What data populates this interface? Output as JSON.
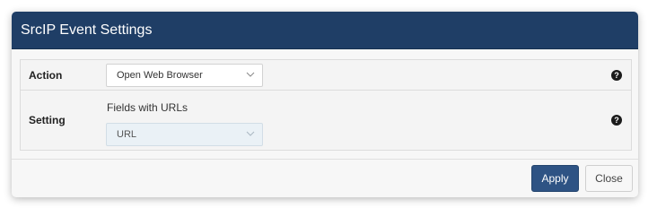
{
  "dialog": {
    "title": "SrcIP Event Settings"
  },
  "rows": {
    "action": {
      "label": "Action",
      "select_value": "Open Web Browser",
      "help": "?"
    },
    "setting": {
      "label": "Setting",
      "field_label": "Fields with URLs",
      "select_value": "URL",
      "help": "?"
    }
  },
  "buttons": {
    "apply": "Apply",
    "close": "Close"
  },
  "colors": {
    "header_bg": "#1f3e66",
    "apply_bg": "#2e5384",
    "disabled_select_bg": "#eaf1f6"
  }
}
